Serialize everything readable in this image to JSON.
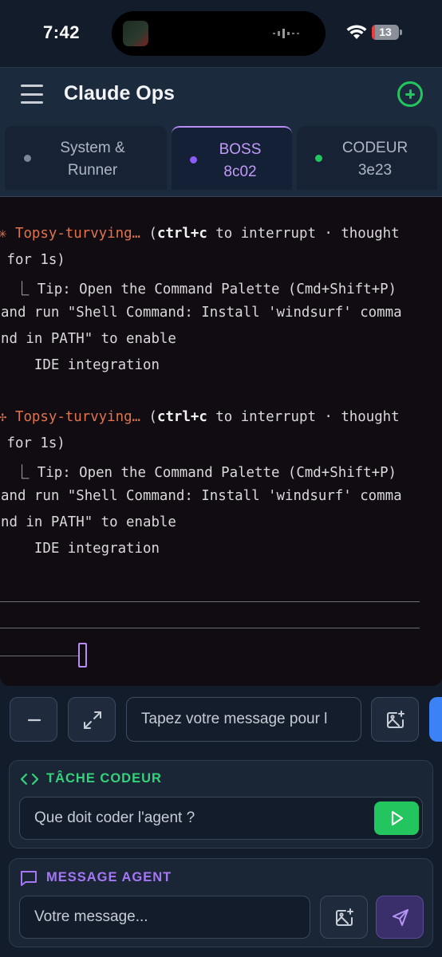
{
  "status_bar": {
    "time": "7:42",
    "battery_level": "13",
    "battery_fraction": 0.13
  },
  "header": {
    "title": "Claude Ops",
    "menu_icon": "hamburger-menu-icon",
    "add_icon": "plus-circle-icon"
  },
  "tabs": [
    {
      "label": "System &\nRunner",
      "dot_color": "#7d8799",
      "active": false
    },
    {
      "label": "BOSS\n8c02",
      "dot_color": "#8b5cf6",
      "active": true
    },
    {
      "label": "CODEUR\n3e23",
      "dot_color": "#22c55e",
      "active": false
    }
  ],
  "terminal": {
    "blocks": [
      {
        "spinner": "✳",
        "status": "Topsy-turvying…",
        "open": " (",
        "key": "ctrl+c",
        "rest": " to interrupt · thought",
        "cont": " for 1s)",
        "tip1": "  ⎿ Tip: Open the Command Palette (Cmd+Shift+P)",
        "tip2": "and run \"Shell Command: Install 'windsurf' comma",
        "tip3": "nd in PATH\" to enable",
        "tip4": "    IDE integration"
      },
      {
        "spinner": "✢",
        "status": "Topsy-turvying…",
        "open": " (",
        "key": "ctrl+c",
        "rest": " to interrupt · thought",
        "cont": " for 1s)",
        "tip1": "  ⎿ Tip: Open the Command Palette (Cmd+Shift+P)",
        "tip2": "and run \"Shell Command: Install 'windsurf' comma",
        "tip3": "nd in PATH\" to enable",
        "tip4": "    IDE integration"
      }
    ]
  },
  "input_bar": {
    "message_placeholder": "Tapez votre message pour l",
    "minimize_icon": "minus-icon",
    "expand_icon": "expand-arrows-icon",
    "image_icon": "image-add-icon"
  },
  "coder_panel": {
    "title": "TÂCHE CODEUR",
    "title_color": "#34d27b",
    "icon": "code-brackets-icon",
    "placeholder": "Que doit coder l'agent ?",
    "run_icon": "play-icon"
  },
  "agent_panel": {
    "title": "MESSAGE AGENT",
    "title_color": "#a577f5",
    "icon": "chat-bubble-icon",
    "placeholder": "Votre message...",
    "image_icon": "image-add-icon",
    "send_icon": "send-paper-plane-icon"
  }
}
